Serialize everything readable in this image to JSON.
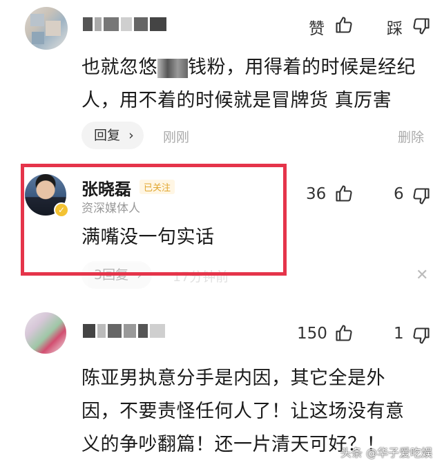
{
  "comments": [
    {
      "username": "",
      "comment_line1": "也就忽悠",
      "comment_line1b": "钱粉，用得着的时候是经纪",
      "comment_line2": "人，用不着的时候就是冒牌货 真厉害",
      "like_label": "赞",
      "dislike_label": "踩",
      "reply_label": "回复",
      "time": "刚刚",
      "delete_label": "删除"
    },
    {
      "username": "张晓磊",
      "follow_badge": "已关注",
      "subtitle": "资深媒体人",
      "comment": "满嘴没一句实话",
      "like_count": "36",
      "dislike_count": "6",
      "reply_label": "3回复",
      "time": "17分钟前"
    },
    {
      "username": "",
      "comment_line1": "陈亚男执意分手是内因，其它全是外",
      "comment_line2": "因，不要责怪任何人了！让这场没有意",
      "comment_line3": "义的争吵翻篇！还一片清天可好？！",
      "like_count": "150",
      "dislike_count": "1"
    }
  ],
  "watermark": "头条 @华子爱吃娱",
  "colors": {
    "highlight": "#e5344a",
    "follow_badge": "#e0a630",
    "muted": "#999999"
  },
  "icons": [
    "thumbs-up-icon",
    "thumbs-down-icon",
    "chevron-right-icon",
    "close-icon",
    "verified-badge-icon"
  ]
}
